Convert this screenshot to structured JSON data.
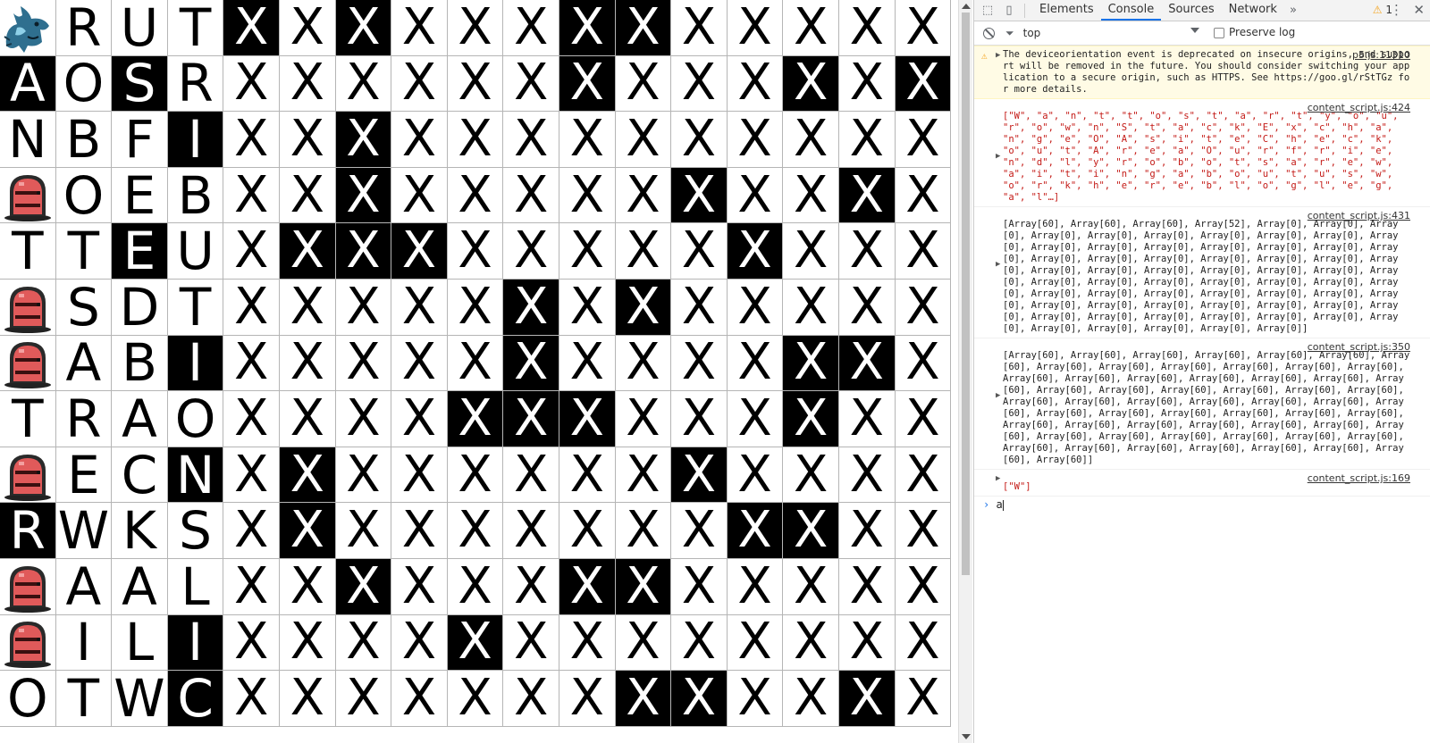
{
  "grid": {
    "rows": [
      [
        "@mon",
        "R",
        "U",
        "T",
        "X",
        "X",
        "X",
        "X",
        "X",
        "X",
        "X",
        "X",
        "X",
        "X",
        "X",
        "X",
        "X"
      ],
      [
        "A",
        "O",
        "S",
        "R",
        "X",
        "X",
        "X",
        "X",
        "X",
        "X",
        "X",
        "X",
        "X",
        "X",
        "X",
        "X",
        "X"
      ],
      [
        "N",
        "B",
        "F",
        "I",
        "X",
        "X",
        "X",
        "X",
        "X",
        "X",
        "X",
        "X",
        "X",
        "X",
        "X",
        "X",
        "X"
      ],
      [
        "@bell",
        "O",
        "E",
        "B",
        "X",
        "X",
        "X",
        "X",
        "X",
        "X",
        "X",
        "X",
        "X",
        "X",
        "X",
        "X",
        "X"
      ],
      [
        "T",
        "T",
        "E",
        "U",
        "X",
        "X",
        "X",
        "X",
        "X",
        "X",
        "X",
        "X",
        "X",
        "X",
        "X",
        "X",
        "X"
      ],
      [
        "@bell",
        "S",
        "D",
        "T",
        "X",
        "X",
        "X",
        "X",
        "X",
        "X",
        "X",
        "X",
        "X",
        "X",
        "X",
        "X",
        "X"
      ],
      [
        "@bell",
        "A",
        "B",
        "I",
        "X",
        "X",
        "X",
        "X",
        "X",
        "X",
        "X",
        "X",
        "X",
        "X",
        "X",
        "X",
        "X"
      ],
      [
        "T",
        "R",
        "A",
        "O",
        "X",
        "X",
        "X",
        "X",
        "X",
        "X",
        "X",
        "X",
        "X",
        "X",
        "X",
        "X",
        "X"
      ],
      [
        "@bell",
        "E",
        "C",
        "N",
        "X",
        "X",
        "X",
        "X",
        "X",
        "X",
        "X",
        "X",
        "X",
        "X",
        "X",
        "X",
        "X"
      ],
      [
        "R",
        "W",
        "K",
        "S",
        "X",
        "X",
        "X",
        "X",
        "X",
        "X",
        "X",
        "X",
        "X",
        "X",
        "X",
        "X",
        "X"
      ],
      [
        "@bell",
        "A",
        "A",
        "L",
        "X",
        "X",
        "X",
        "X",
        "X",
        "X",
        "X",
        "X",
        "X",
        "X",
        "X",
        "X",
        "X"
      ],
      [
        "@bell",
        "I",
        "L",
        "I",
        "X",
        "X",
        "X",
        "X",
        "X",
        "X",
        "X",
        "X",
        "X",
        "X",
        "X",
        "X",
        "X"
      ],
      [
        "O",
        "T",
        "W",
        "C",
        "X",
        "X",
        "X",
        "X",
        "X",
        "X",
        "X",
        "X",
        "X",
        "X",
        "X",
        "X",
        "X"
      ]
    ],
    "dark": [
      "10001010001100000",
      "10100000001000101",
      "00010010000000000",
      "00000010000010010",
      "00100111000001000",
      "00000000010100000",
      "00010000010000110",
      "00000000111000100",
      "00010100000010000",
      "10000100000001100",
      "00000010001100000",
      "00010000100000000",
      "00010000000110010"
    ]
  },
  "devtools": {
    "tabs": [
      "Elements",
      "Console",
      "Sources",
      "Network"
    ],
    "active_tab": "Console",
    "more": "»",
    "warning_count": "1",
    "context": "top",
    "preserve_log": "Preserve log",
    "messages": [
      {
        "kind": "warn",
        "source": "p5.js:11310",
        "text": "The deviceorientation event is deprecated on insecure origins, and support will be removed in the future. You should consider switching your application to a secure origin, such as HTTPS. See https://goo.gl/rStTGz for more details."
      },
      {
        "kind": "array",
        "source": "content_script.js:424",
        "text": "[\"W\", \"a\", \"n\", \"t\", \"t\", \"o\", \"s\", \"t\", \"a\", \"r\", \"t\", \"y\", \"o\", \"u\", \"r\", \"o\", \"w\", \"n\", \"S\", \"t\", \"a\", \"c\", \"k\", \"E\", \"x\", \"c\", \"h\", \"a\", \"n\", \"g\", \"e\", \"O\", \"A\", \"s\", \"i\", \"t\", \"e\", \"C\", \"h\", \"e\", \"c\", \"k\", \"o\", \"u\", \"t\", \"A\", \"r\", \"e\", \"a\", \"O\", \"u\", \"r\", \"f\", \"r\", \"i\", \"e\", \"n\", \"d\", \"l\", \"y\", \"r\", \"o\", \"b\", \"o\", \"t\", \"s\", \"a\", \"r\", \"e\", \"w\", \"a\", \"i\", \"t\", \"i\", \"n\", \"g\", \"a\", \"b\", \"o\", \"u\", \"t\", \"u\", \"s\", \"w\", \"o\", \"r\", \"k\", \"h\", \"e\", \"r\", \"e\", \"b\", \"l\", \"o\", \"g\", \"l\", \"e\", \"g\", \"a\", \"l\"…]"
      },
      {
        "kind": "plain",
        "source": "content_script.js:431",
        "text": "[Array[60], Array[60], Array[60], Array[52], Array[0], Array[0], Array[0], Array[0], Array[0], Array[0], Array[0], Array[0], Array[0], Array[0], Array[0], Array[0], Array[0], Array[0], Array[0], Array[0], Array[0], Array[0], Array[0], Array[0], Array[0], Array[0], Array[0], Array[0], Array[0], Array[0], Array[0], Array[0], Array[0], Array[0], Array[0], Array[0], Array[0], Array[0], Array[0], Array[0], Array[0], Array[0], Array[0], Array[0], Array[0], Array[0], Array[0], Array[0], Array[0], Array[0], Array[0], Array[0], Array[0], Array[0], Array[0], Array[0], Array[0], Array[0], Array[0], Array[0], Array[0], Array[0], Array[0], Array[0], Array[0], Array[0], Array[0], Array[0]]"
      },
      {
        "kind": "plain",
        "source": "content_script.js:350",
        "text": "[Array[60], Array[60], Array[60], Array[60], Array[60], Array[60], Array[60], Array[60], Array[60], Array[60], Array[60], Array[60], Array[60], Array[60], Array[60], Array[60], Array[60], Array[60], Array[60], Array[60], Array[60], Array[60], Array[60], Array[60], Array[60], Array[60], Array[60], Array[60], Array[60], Array[60], Array[60], Array[60], Array[60], Array[60], Array[60], Array[60], Array[60], Array[60], Array[60], Array[60], Array[60], Array[60], Array[60], Array[60], Array[60], Array[60], Array[60], Array[60], Array[60], Array[60], Array[60], Array[60], Array[60], Array[60], Array[60], Array[60], Array[60], Array[60], Array[60], Array[60]]"
      },
      {
        "kind": "array",
        "source": "content_script.js:169",
        "text": "[\"W\"]"
      }
    ],
    "prompt_input": "a"
  },
  "colors": {
    "accent": "#1a73e8",
    "warn_bg": "#fffbe5",
    "string_red": "#c41a16",
    "bell_red": "#e05a5a"
  }
}
